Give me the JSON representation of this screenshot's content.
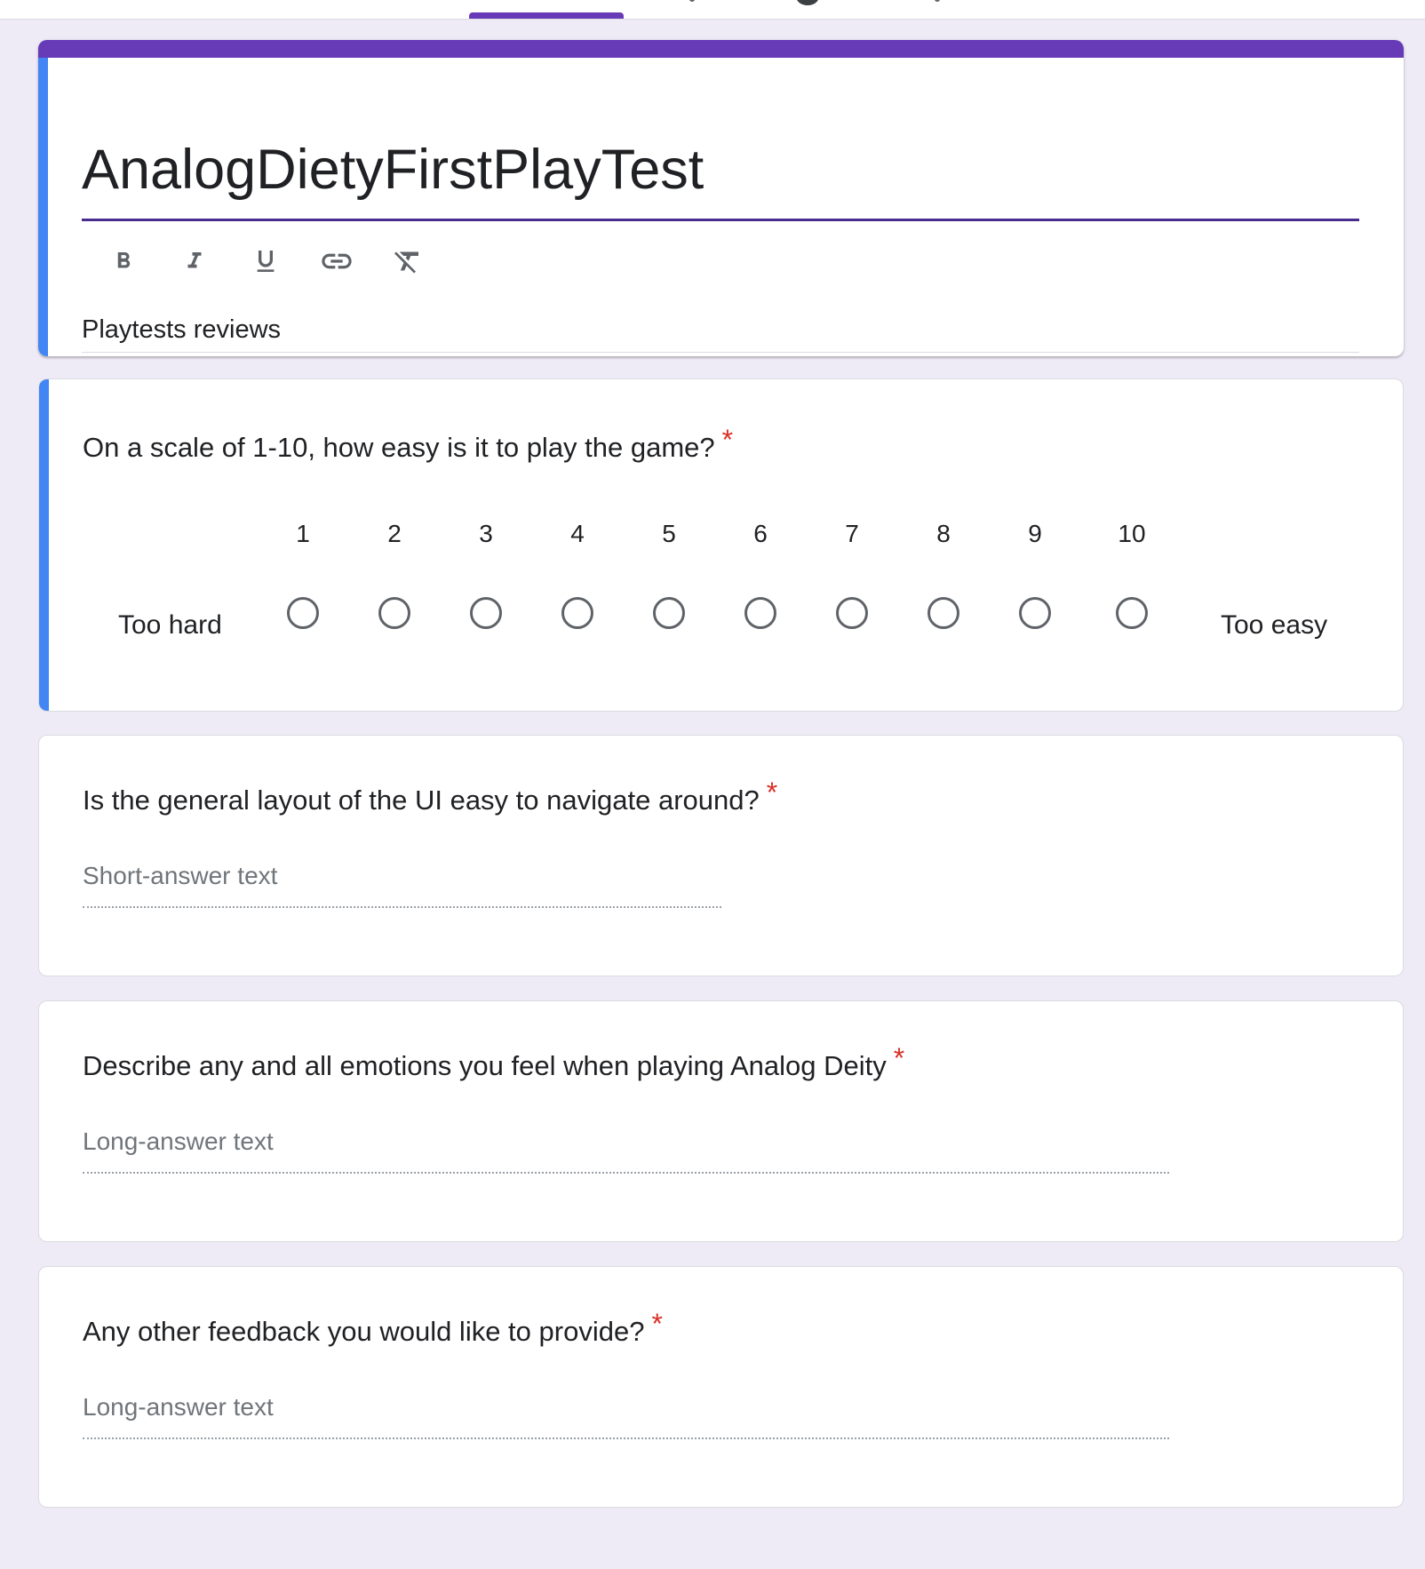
{
  "form": {
    "title": "AnalogDietyFirstPlayTest",
    "description": "Playtests reviews",
    "accent_color": "#673ab7",
    "active_bar_color": "#4285f4",
    "background_color": "#eeeaf6",
    "toolbar": {
      "buttons": [
        {
          "name": "bold",
          "icon": "bold-icon"
        },
        {
          "name": "italic",
          "icon": "italic-icon"
        },
        {
          "name": "underline",
          "icon": "underline-icon"
        },
        {
          "name": "link",
          "icon": "link-icon"
        },
        {
          "name": "clear-formatting",
          "icon": "clear-formatting-icon"
        }
      ]
    }
  },
  "questions": [
    {
      "title": "On a scale of 1-10, how easy is it to play the game?",
      "required_mark": "*",
      "type": "linear-scale",
      "low_label": "Too hard",
      "high_label": "Too easy",
      "scale": [
        "1",
        "2",
        "3",
        "4",
        "5",
        "6",
        "7",
        "8",
        "9",
        "10"
      ]
    },
    {
      "title": "Is the general layout of the UI easy to navigate around?",
      "required_mark": "*",
      "type": "short-answer",
      "placeholder": "Short-answer text"
    },
    {
      "title": "Describe any and all emotions you feel when playing Analog Deity",
      "required_mark": "*",
      "type": "long-answer",
      "placeholder": "Long-answer text"
    },
    {
      "title": "Any other feedback you would like to provide?",
      "required_mark": "*",
      "type": "long-answer",
      "placeholder": "Long-answer text"
    }
  ],
  "required_color": "#d93025"
}
